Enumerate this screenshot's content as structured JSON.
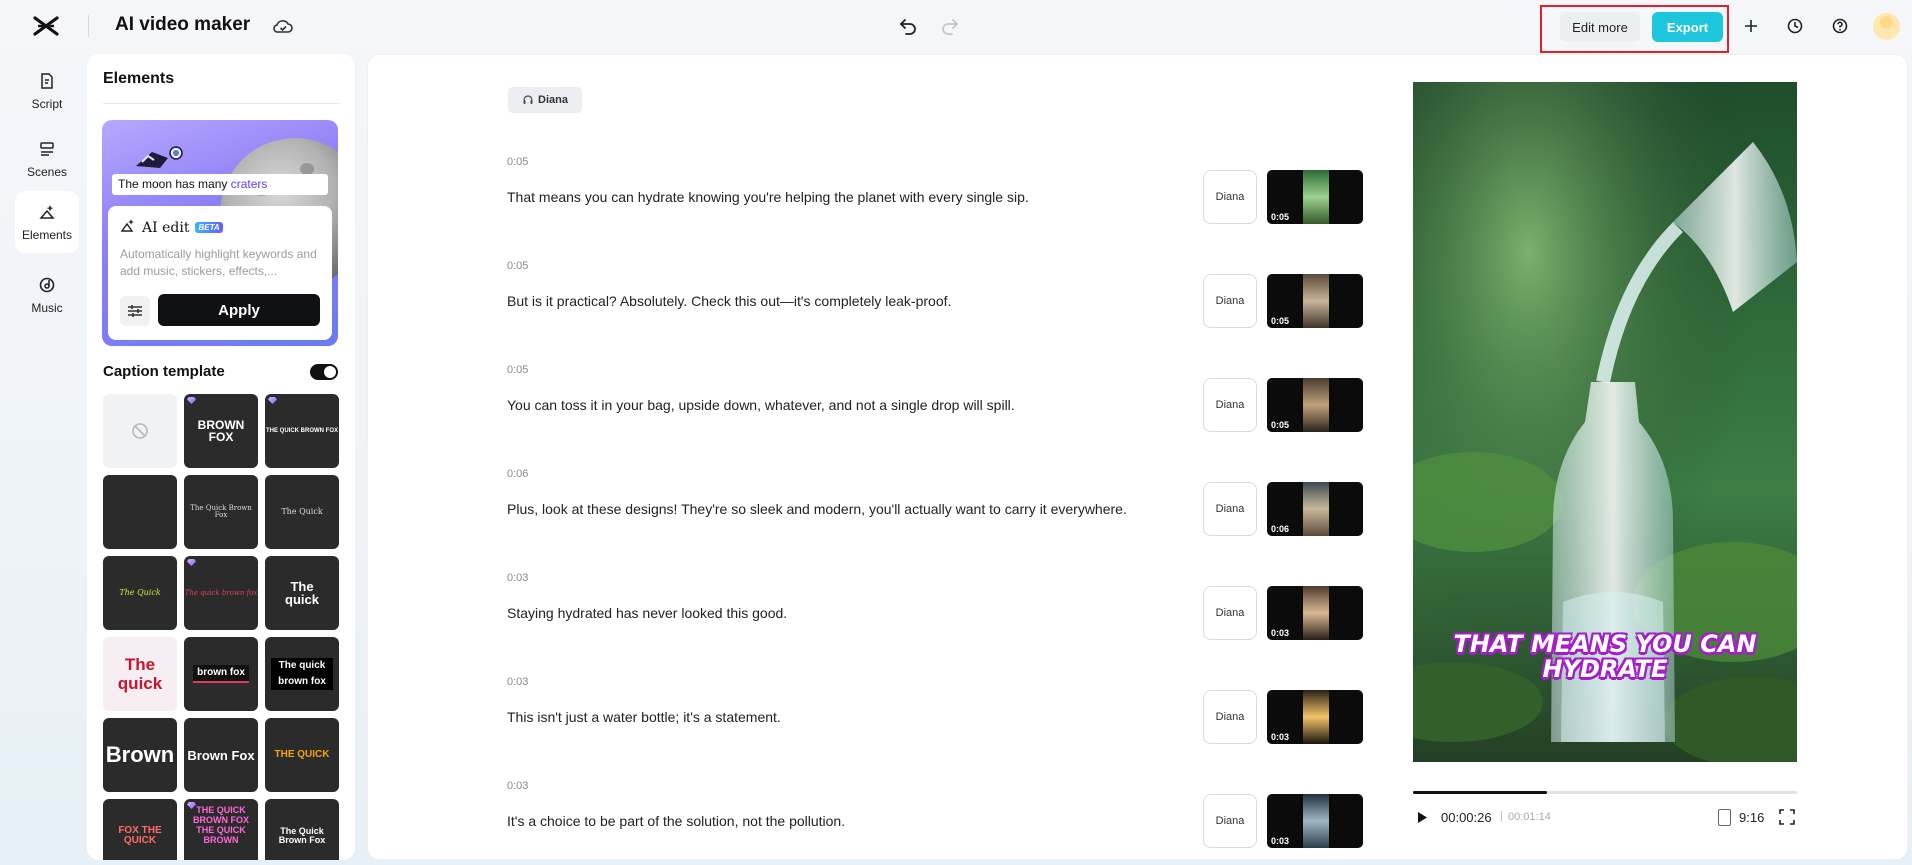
{
  "header": {
    "app_title": "AI video maker",
    "edit_more_label": "Edit more",
    "export_label": "Export"
  },
  "nav": [
    {
      "label": "Script"
    },
    {
      "label": "Scenes"
    },
    {
      "label": "Elements"
    },
    {
      "label": "Music"
    }
  ],
  "panel": {
    "title": "Elements",
    "ai_card": {
      "sample_caption_prefix": "The moon has many",
      "sample_caption_keyword": "craters",
      "title": "AI edit",
      "badge": "BETA",
      "description": "Automatically highlight keywords and add music, stickers, effects,...",
      "apply_label": "Apply"
    },
    "caption_template_label": "Caption template",
    "caption_templates_enabled": true,
    "templates": [
      {
        "text": ""
      },
      {
        "text": "BROWN FOX"
      },
      {
        "text": "THE QUICK BROWN FOX"
      },
      {
        "text": ""
      },
      {
        "text": "The Quick Brown Fox"
      },
      {
        "text": "The Quick"
      },
      {
        "text": "The Quick"
      },
      {
        "text": "The quick brown fox"
      },
      {
        "text": "The quick"
      },
      {
        "text": "The quick"
      },
      {
        "text": "brown fox"
      },
      {
        "text": "The quick brown fox"
      },
      {
        "text": "Brown"
      },
      {
        "text": "Brown Fox"
      },
      {
        "text": "THE QUICK"
      },
      {
        "text": "FOX THE QUICK"
      },
      {
        "text": "THE QUICK BROWN FOX THE QUICK BROWN"
      },
      {
        "text": "The Quick Brown Fox"
      }
    ]
  },
  "script": {
    "speaker": "Diana",
    "segments": [
      {
        "time": "0:05",
        "text": "That means you can hydrate knowing you're helping the planet with every single sip.",
        "voice": "Diana",
        "duration": "0:05"
      },
      {
        "time": "0:05",
        "text": "But is it practical? Absolutely. Check this out—it's completely leak-proof.",
        "voice": "Diana",
        "duration": "0:05"
      },
      {
        "time": "0:05",
        "text": "You can toss it in your bag, upside down, whatever, and not a single drop will spill.",
        "voice": "Diana",
        "duration": "0:05"
      },
      {
        "time": "0:06",
        "text": "Plus, look at these designs! They're so sleek and modern, you'll actually want to carry it everywhere.",
        "voice": "Diana",
        "duration": "0:06"
      },
      {
        "time": "0:03",
        "text": "Staying hydrated has never looked this good.",
        "voice": "Diana",
        "duration": "0:03"
      },
      {
        "time": "0:03",
        "text": "This isn't just a water bottle; it's a statement.",
        "voice": "Diana",
        "duration": "0:03"
      },
      {
        "time": "0:03",
        "text": "It's a choice to be part of the solution, not the pollution.",
        "voice": "Diana",
        "duration": "0:03"
      }
    ]
  },
  "preview": {
    "caption_line1": "THAT MEANS YOU CAN",
    "caption_line2": "HYDRATE",
    "current_time": "00:00:26",
    "total_time": "00:01:14",
    "progress": 0.35,
    "aspect_ratio": "9:16"
  },
  "colors": {
    "accent": "#1ec6dd",
    "highlight_box": "#e0202a",
    "caption_outline": "#a51cc9"
  }
}
